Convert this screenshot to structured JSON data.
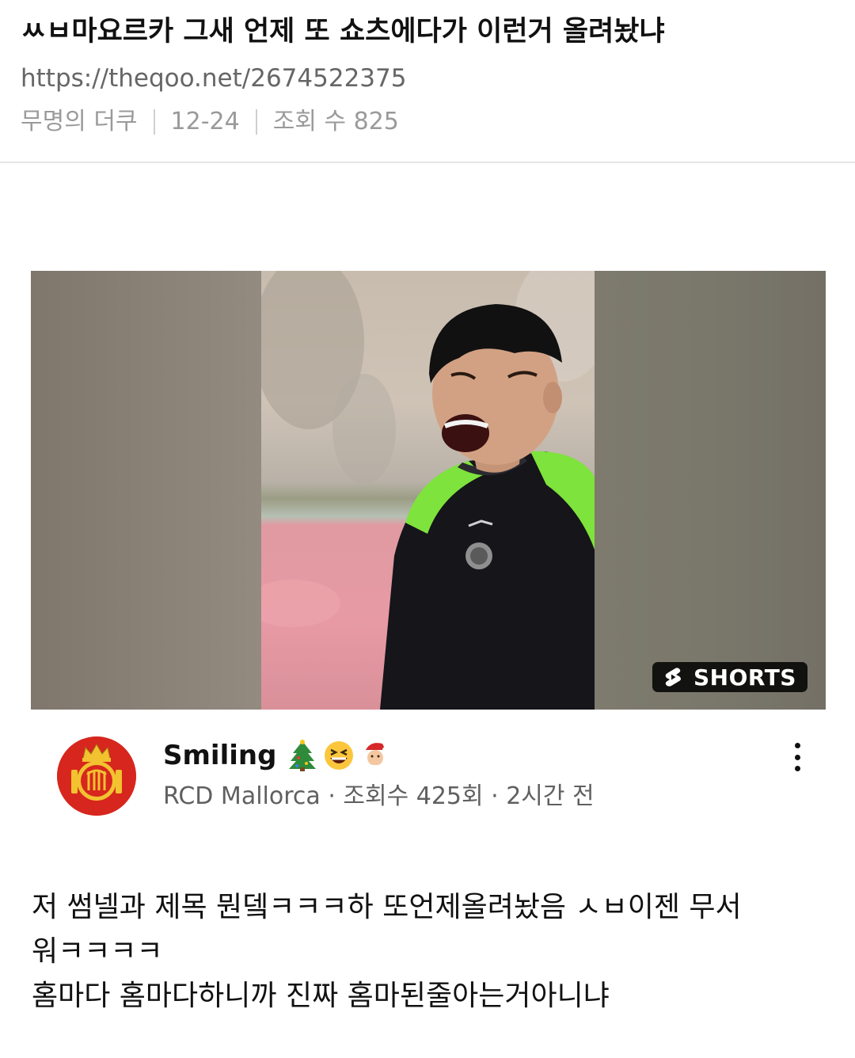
{
  "post": {
    "title": "ㅆㅂ마요르카 그새 언제 또 쇼츠에다가 이런거 올려놨냐",
    "url": "https://theqoo.net/2674522375",
    "author": "무명의 더쿠",
    "date": "12-24",
    "views": "조회 수 825"
  },
  "video": {
    "badge_label": "SHORTS",
    "title": "Smiling",
    "title_emojis": [
      "christmas-tree",
      "laughing-face",
      "santa"
    ],
    "channel": "RCD Mallorca",
    "channel_views": "조회수 425회",
    "time_ago": "2시간 전",
    "separator": " · "
  },
  "body": {
    "lines": [
      "저 썸넬과 제목 뭔뎈ㅋㅋㅋ하 또언제올려놨음 ㅅㅂ이젠 무서",
      "워ㅋㅋㅋㅋ",
      "홈마다 홈마다하니까 진짜 홈마된줄아는거아니냐"
    ]
  },
  "colors": {
    "shorts_badge_bg": "#111111",
    "jersey_green": "#7ee33c",
    "club_red": "#d7261e",
    "club_gold": "#f2c230"
  }
}
